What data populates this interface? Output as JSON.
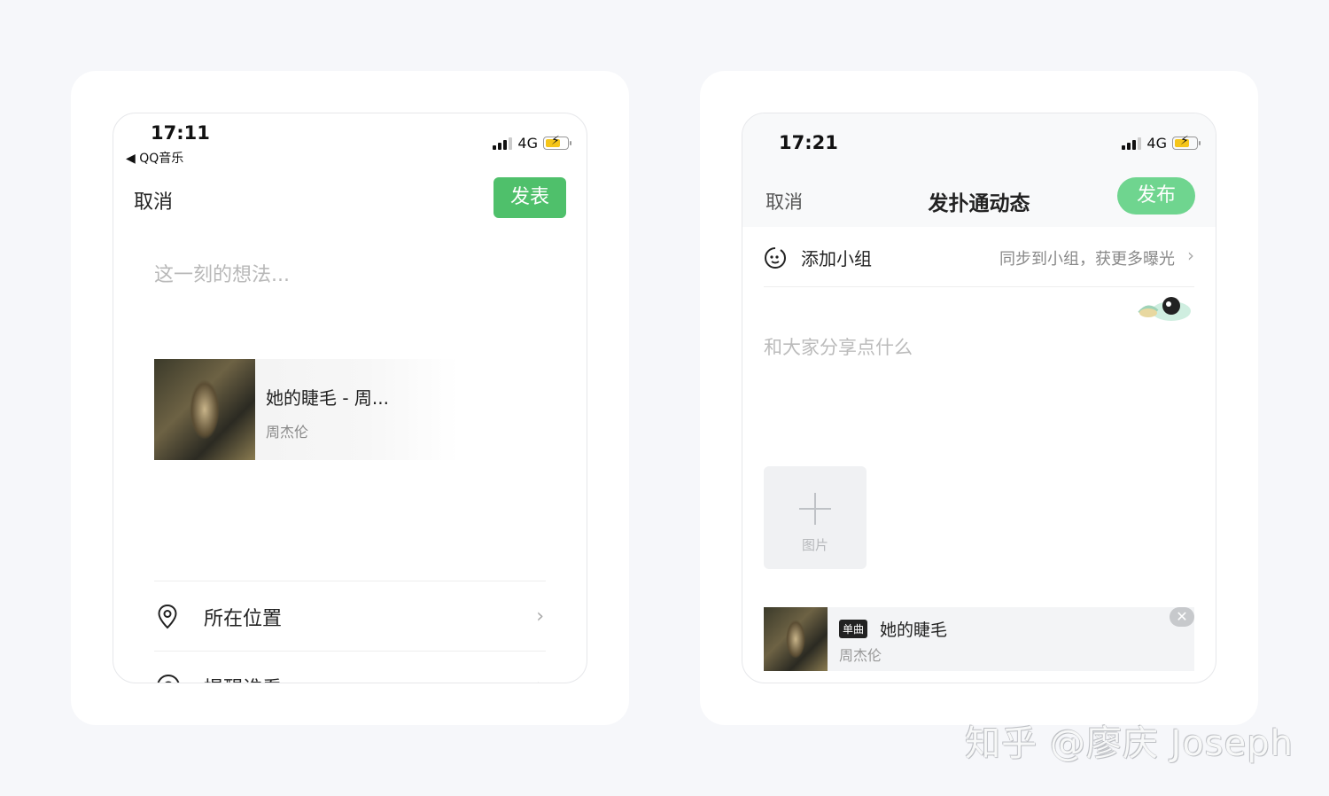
{
  "left_phone": {
    "status": {
      "time": "17:11",
      "back_app": "◀ QQ音乐",
      "network": "4G"
    },
    "nav": {
      "cancel": "取消",
      "publish": "发表"
    },
    "placeholder": "这一刻的想法...",
    "song": {
      "title": "她的睫毛 - 周...",
      "artist": "周杰伦"
    },
    "rows": [
      {
        "label": "所在位置",
        "icon": "location-pin-icon"
      },
      {
        "label": "提醒谁看",
        "icon": "at-icon"
      }
    ]
  },
  "right_phone": {
    "status": {
      "time": "17:21",
      "network": "4G"
    },
    "nav": {
      "cancel": "取消",
      "title": "发扑通动态",
      "publish": "发布"
    },
    "group": {
      "label": "添加小组",
      "hint": "同步到小组，获更多曝光"
    },
    "placeholder": "和大家分享点什么",
    "add_image_label": "图片",
    "music": {
      "badge": "单曲",
      "title": "她的睫毛",
      "artist": "周杰伦"
    }
  },
  "watermark": "知乎 @廖庆 Joseph",
  "colors": {
    "green": "#4fc06b",
    "light_green": "#6fd58f",
    "battery": "#f5c518"
  }
}
